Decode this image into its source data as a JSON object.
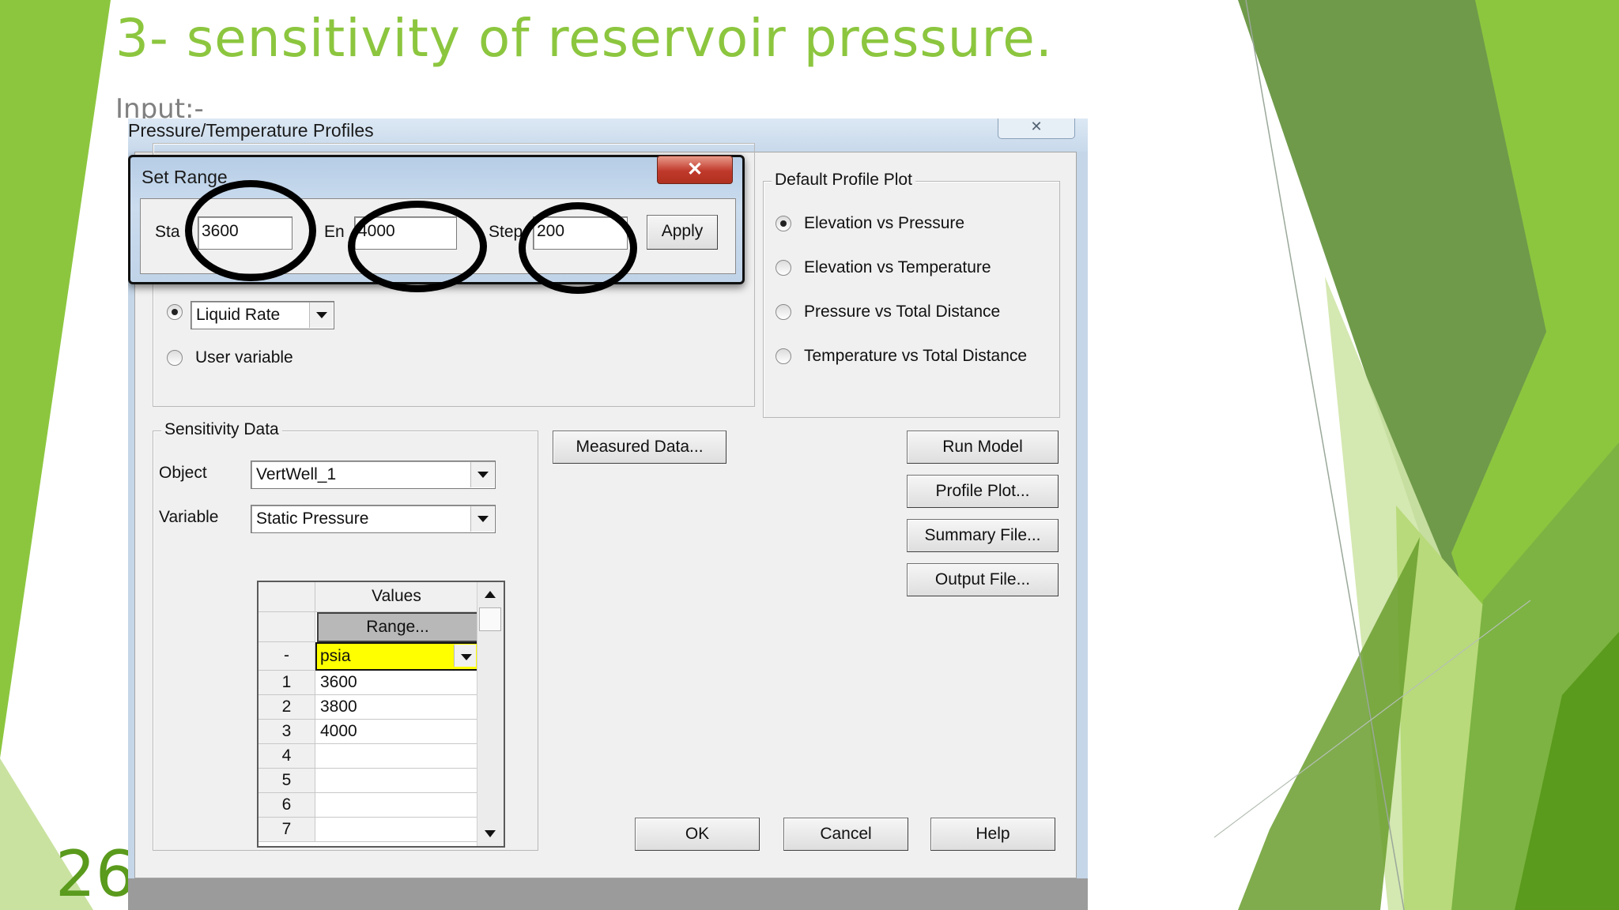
{
  "slide": {
    "title": "3- sensitivity of reservoir pressure.",
    "subtitle": "Input:-",
    "page_number": "26",
    "accent_color": "#8cc63f"
  },
  "window": {
    "title": "Pressure/Temperature Profiles",
    "close_glyph": "✕"
  },
  "set_range": {
    "title": "Set Range",
    "close_glyph": "✕",
    "start_label": "Sta",
    "start_value": "3600",
    "end_label": "En",
    "end_value": "4000",
    "step_label": "Step",
    "step_value": "200",
    "apply_label": "Apply"
  },
  "x_axis": {
    "liquid_rate_value": "Liquid Rate",
    "user_variable_label": "User variable"
  },
  "default_profile_plot": {
    "label": "Default Profile Plot",
    "options": [
      "Elevation vs Pressure",
      "Elevation vs Temperature",
      "Pressure vs Total Distance",
      "Temperature vs Total Distance"
    ],
    "selected": "Elevation vs Pressure"
  },
  "sensitivity": {
    "label": "Sensitivity Data",
    "object_label": "Object",
    "object_value": "VertWell_1",
    "variable_label": "Variable",
    "variable_value": "Static Pressure",
    "values_header": "Values",
    "range_button": "Range...",
    "unit_row_marker": "-",
    "unit_value": "psia",
    "unit_highlight": "#ffff00",
    "rows": [
      {
        "n": "1",
        "v": "3600"
      },
      {
        "n": "2",
        "v": "3800"
      },
      {
        "n": "3",
        "v": "4000"
      },
      {
        "n": "4",
        "v": ""
      },
      {
        "n": "5",
        "v": ""
      },
      {
        "n": "6",
        "v": ""
      },
      {
        "n": "7",
        "v": ""
      }
    ]
  },
  "buttons": {
    "measured_data": "Measured Data...",
    "run_model": "Run Model",
    "profile_plot": "Profile Plot...",
    "summary_file": "Summary File...",
    "output_file": "Output File...",
    "ok": "OK",
    "cancel": "Cancel",
    "help": "Help"
  }
}
